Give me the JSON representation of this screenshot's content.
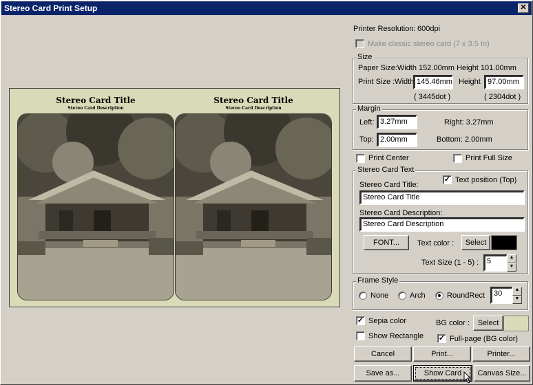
{
  "window": {
    "title": "Stereo Card Print Setup",
    "close": "✕"
  },
  "printer": {
    "resolution_label": "Printer Resolution:",
    "resolution_value": "600dpi",
    "classic_label": "Make classic stereo card (7 x 3.5 In)"
  },
  "size": {
    "group_title": "Size",
    "paper_size": "Paper Size:Width 152.00mm Height 101.00mm",
    "print_width_label": "Print Size :Width",
    "print_width_value": "145.46mm",
    "height_label": "Height",
    "height_value": "97.00mm",
    "width_dots": "( 3445dot )",
    "height_dots": "( 2304dot )"
  },
  "margin": {
    "group_title": "Margin",
    "left_label": "Left:",
    "left_value": "3.27mm",
    "top_label": "Top:",
    "top_value": "2.00mm",
    "right_text": "Right:  3.27mm",
    "bottom_text": "Bottom:  2.00mm"
  },
  "options": {
    "print_center": "Print Center",
    "print_full_size": "Print Full Size"
  },
  "card_text": {
    "group_title": "Stereo Card Text",
    "text_position": "Text position (Top)",
    "title_label": "Stereo Card Title:",
    "title_value": "Stereo Card Title",
    "desc_label": "Stereo Card Description:",
    "desc_value": "Stereo Card Description",
    "font_button": "FONT...",
    "text_color_label": "Text color :",
    "select_label": "Select",
    "text_color": "#000000",
    "text_size_label": "Text Size (1 - 5) :",
    "text_size_value": "5"
  },
  "frame_style": {
    "group_title": "Frame Style",
    "none": "None",
    "arch": "Arch",
    "roundrect": "RoundRect",
    "selected": "RoundRect",
    "radius_value": "30"
  },
  "bottom_opts": {
    "sepia": "Sepia color",
    "show_rect": "Show Rectangle",
    "bg_color_label": "BG color :",
    "bg_select": "Select",
    "bg_color": "#d9dbb8",
    "full_page": "Full-page (BG color)"
  },
  "buttons": {
    "cancel": "Cancel",
    "print": "Print...",
    "printer": "Printer...",
    "save_as": "Save as...",
    "show_card": "Show Card",
    "canvas_size": "Canvas Size..."
  },
  "preview": {
    "card_title": "Stereo Card Title",
    "card_desc": "Stereo Card Description"
  }
}
